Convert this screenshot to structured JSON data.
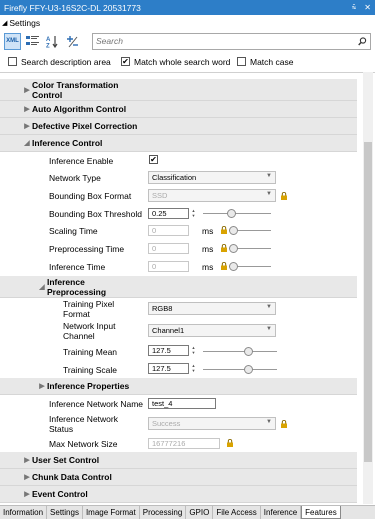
{
  "window": {
    "title": "Firefly FFY-U3-16S2C-DL 20531773",
    "pin_icon": "pin-icon",
    "close_icon": "close-icon"
  },
  "settings": {
    "label": "Settings"
  },
  "toolbar": {
    "xml_label": "XML",
    "search_placeholder": "Search"
  },
  "options": {
    "search_description": {
      "label": "Search description area",
      "checked": false
    },
    "match_whole_word": {
      "label": "Match whole search word",
      "checked": true
    },
    "match_case": {
      "label": "Match case",
      "checked": false
    }
  },
  "categories": {
    "color_transformation": "Color Transformation Control",
    "auto_algorithm": "Auto Algorithm Control",
    "defective_pixel": "Defective Pixel Correction",
    "inference_control": "Inference Control",
    "inference_preprocessing": "Inference Preprocessing",
    "inference_properties": "Inference Properties",
    "user_set": "User Set Control",
    "chunk_data": "Chunk Data Control",
    "event_control": "Event Control"
  },
  "props": {
    "inference_enable": {
      "label": "Inference Enable",
      "checked": true
    },
    "network_type": {
      "label": "Network Type",
      "value": "Classification"
    },
    "bbox_format": {
      "label": "Bounding Box Format",
      "value": "SSD"
    },
    "bbox_threshold": {
      "label": "Bounding Box Threshold",
      "value": "0.25"
    },
    "scaling_time": {
      "label": "Scaling Time",
      "value": "0",
      "unit": "ms"
    },
    "preprocessing_time": {
      "label": "Preprocessing Time",
      "value": "0",
      "unit": "ms"
    },
    "inference_time": {
      "label": "Inference Time",
      "value": "0",
      "unit": "ms"
    },
    "training_pixel_format": {
      "label": "Training Pixel Format",
      "value": "RGB8"
    },
    "network_input_channel": {
      "label": "Network Input Channel",
      "value": "Channel1"
    },
    "training_mean": {
      "label": "Training Mean",
      "value": "127.5"
    },
    "training_scale": {
      "label": "Training Scale",
      "value": "127.5"
    },
    "inference_network_name": {
      "label": "Inference Network Name",
      "value": "test_4"
    },
    "inference_network_status": {
      "label": "Inference Network Status",
      "value": "Success"
    },
    "max_network_size": {
      "label": "Max Network Size",
      "value": "16777216"
    }
  },
  "tabs": [
    "Information",
    "Settings",
    "Image Format",
    "Processing",
    "GPIO",
    "File Access",
    "Inference",
    "Features"
  ],
  "active_tab": "Features",
  "colors": {
    "titlebar": "#2d7ec8",
    "category_bg": "#e8e8e8",
    "lock": "#d9a300"
  }
}
